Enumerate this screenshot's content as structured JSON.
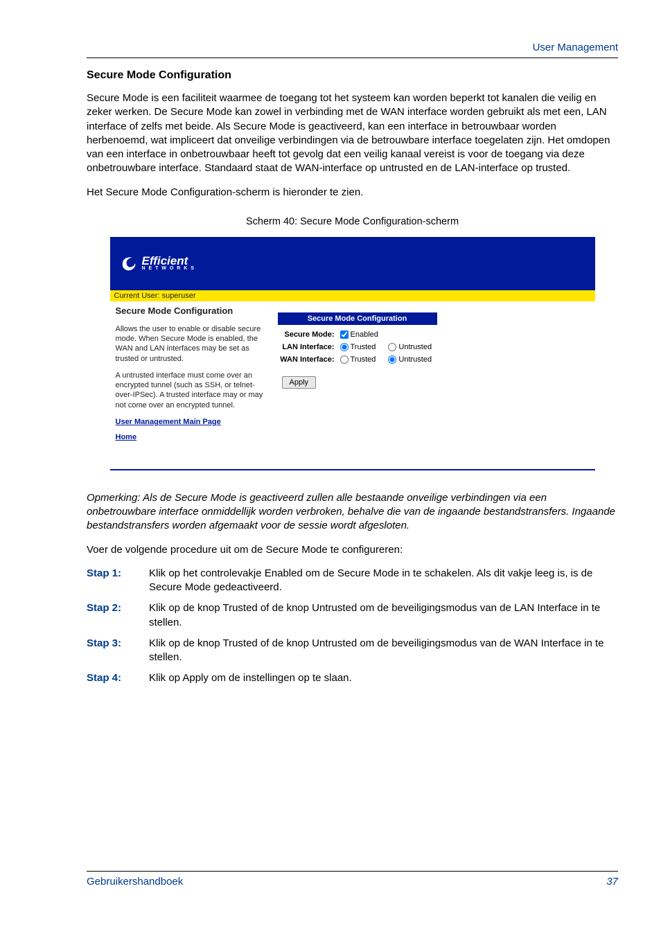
{
  "header": {
    "right": "User Management"
  },
  "title": "Secure Mode Configuration",
  "para1": "Secure Mode is een faciliteit waarmee de toegang tot het systeem kan worden beperkt tot kanalen die veilig en zeker werken. De Secure Mode kan zowel in verbinding met de WAN interface worden gebruikt als met een, LAN interface of zelfs met beide. Als Secure Mode is geactiveerd, kan een interface in betrouwbaar worden herbenoemd, wat impliceert dat onveilige verbindingen via de betrouwbare interface toegelaten zijn. Het omdopen van een interface in onbetrouwbaar heeft tot gevolg dat een veilig kanaal vereist is voor de toegang via deze onbetrouwbare interface. Standaard staat de WAN-interface op untrusted en de LAN-interface op trusted.",
  "para2": "Het Secure Mode Configuration-scherm is hieronder te zien.",
  "caption": "Scherm 40: Secure Mode Configuration-scherm",
  "screenshot": {
    "logo_main": "Efficient",
    "logo_sub": "N E T W O R K S",
    "current_user": "Current User: superuser",
    "left_title": "Secure Mode Configuration",
    "left_p1": "Allows the user to enable or disable secure mode. When Secure Mode is enabled, the WAN and LAN interfaces may be set as trusted or untrusted.",
    "left_p2": "A untrusted interface must come over an encrypted tunnel (such as SSH, or telnet-over-IPSec). A trusted interface may or may not come over an encrypted tunnel.",
    "link1": "User Management Main Page",
    "link2": "Home",
    "form_caption": "Secure Mode Configuration",
    "row1_label": "Secure Mode:",
    "row1_opt": "Enabled",
    "row2_label": "LAN Interface:",
    "row3_label": "WAN Interface:",
    "opt_trusted": "Trusted",
    "opt_untrusted": "Untrusted",
    "apply": "Apply"
  },
  "note": "Opmerking: Als de Secure Mode is geactiveerd zullen alle bestaande onveilige verbindingen via een onbetrouwbare interface onmiddellijk worden verbroken, behalve die van de ingaande bestandstransfers. Ingaande bestandstransfers worden afgemaakt voor de sessie wordt afgesloten.",
  "para3": "Voer de volgende procedure uit om de Secure Mode te configureren:",
  "steps": [
    {
      "label": "Stap 1:",
      "text": "Klik op het controlevakje Enabled om de Secure Mode in te schakelen. Als dit vakje leeg is, is de Secure Mode gedeactiveerd."
    },
    {
      "label": "Stap 2:",
      "text": "Klik op de knop Trusted of de knop Untrusted om de beveiligingsmodus van de LAN Interface in te stellen."
    },
    {
      "label": "Stap 3:",
      "text": "Klik op de knop Trusted of de knop Untrusted om de beveiligingsmodus van de WAN Interface in te stellen."
    },
    {
      "label": "Stap 4:",
      "text": "Klik op Apply om de instellingen op te slaan."
    }
  ],
  "footer": {
    "left": "Gebruikershandboek",
    "right": "37"
  }
}
